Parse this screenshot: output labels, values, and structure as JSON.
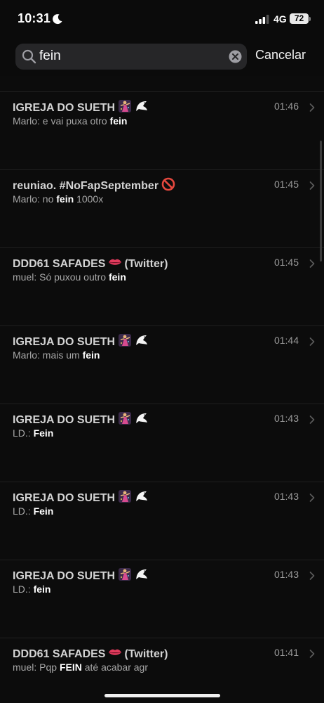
{
  "status_bar": {
    "time": "10:31",
    "network": "4G",
    "battery": "72"
  },
  "search": {
    "query": "fein",
    "cancel_label": "Cancelar"
  },
  "results": [
    {
      "title": "IGREJA DO SUETH",
      "emoji": [
        "dancer-icon",
        "dove-icon"
      ],
      "time": "01:46",
      "sender": "Marlo:",
      "pre": " e vai puxa otro ",
      "match": "fein",
      "post": ""
    },
    {
      "title": "reuniao. #NoFapSeptember",
      "emoji": [
        "prohibited-icon"
      ],
      "time": "01:45",
      "sender": "Marlo:",
      "pre": " no ",
      "match": "fein",
      "post": " 1000x"
    },
    {
      "title": "DDD61 SAFADES",
      "emoji": [
        "lips-icon"
      ],
      "title_suffix": "(Twitter)",
      "time": "01:45",
      "sender": "muel:",
      "pre": " Só puxou outro ",
      "match": "fein",
      "post": ""
    },
    {
      "title": "IGREJA DO SUETH",
      "emoji": [
        "dancer-icon",
        "dove-icon"
      ],
      "time": "01:44",
      "sender": "Marlo:",
      "pre": " mais um ",
      "match": "fein",
      "post": ""
    },
    {
      "title": "IGREJA DO SUETH",
      "emoji": [
        "dancer-icon",
        "dove-icon"
      ],
      "time": "01:43",
      "sender": "LD.:",
      "pre": " ",
      "match": "Fein",
      "post": ""
    },
    {
      "title": "IGREJA DO SUETH",
      "emoji": [
        "dancer-icon",
        "dove-icon"
      ],
      "time": "01:43",
      "sender": "LD.:",
      "pre": " ",
      "match": "Fein",
      "post": ""
    },
    {
      "title": "IGREJA DO SUETH",
      "emoji": [
        "dancer-icon",
        "dove-icon"
      ],
      "time": "01:43",
      "sender": "LD.:",
      "pre": " ",
      "match": "fein",
      "post": ""
    },
    {
      "title": "DDD61 SAFADES",
      "emoji": [
        "lips-icon"
      ],
      "title_suffix": "(Twitter)",
      "time": "01:41",
      "sender": "muel:",
      "pre": " Pqp ",
      "match": "FEIN",
      "post": " até acabar agr"
    }
  ]
}
